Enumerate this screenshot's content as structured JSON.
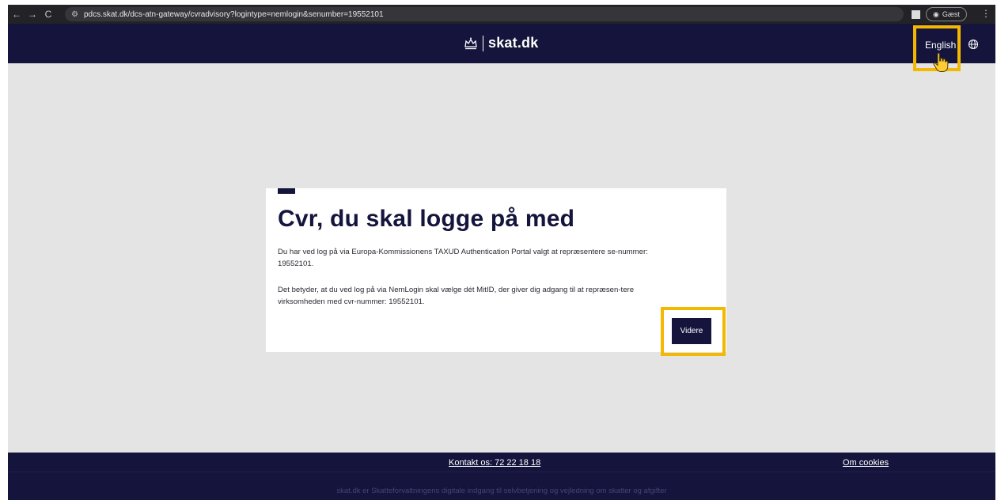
{
  "browser": {
    "nav": {
      "back": "←",
      "forward": "→",
      "reload": "C"
    },
    "site_info_icon": "tune-icon",
    "url": "pdcs.skat.dk/dcs-atn-gateway/cvradvisory?logintype=nemlogin&senumber=19552101",
    "profile_label": "Gæst",
    "menu_icon": "⋮"
  },
  "header": {
    "logo_text": "skat.dk",
    "language_link": "English",
    "bg_color": "#14143c"
  },
  "card": {
    "title": "Cvr, du skal logge på med",
    "paragraph1": "Du har ved log på via Europa-Kommissionens TAXUD Authentication Portal valgt at repræsentere se-nummer: 19552101.",
    "paragraph2": "Det betyder, at du ved log på via NemLogin skal vælge dét MitID, der giver dig adgang til at repræsen-tere virksomheden med cvr-nummer: 19552101.",
    "continue_button": "Videre"
  },
  "footer": {
    "contact_link": "Kontakt os: 72 22 18 18",
    "cookies_link": "Om cookies",
    "tagline": "skat.dk er Skatteforvaltningens digitale indgang til selvbetjening og vejledning om skatter og afgifter"
  },
  "highlight_color": "#f5b800"
}
